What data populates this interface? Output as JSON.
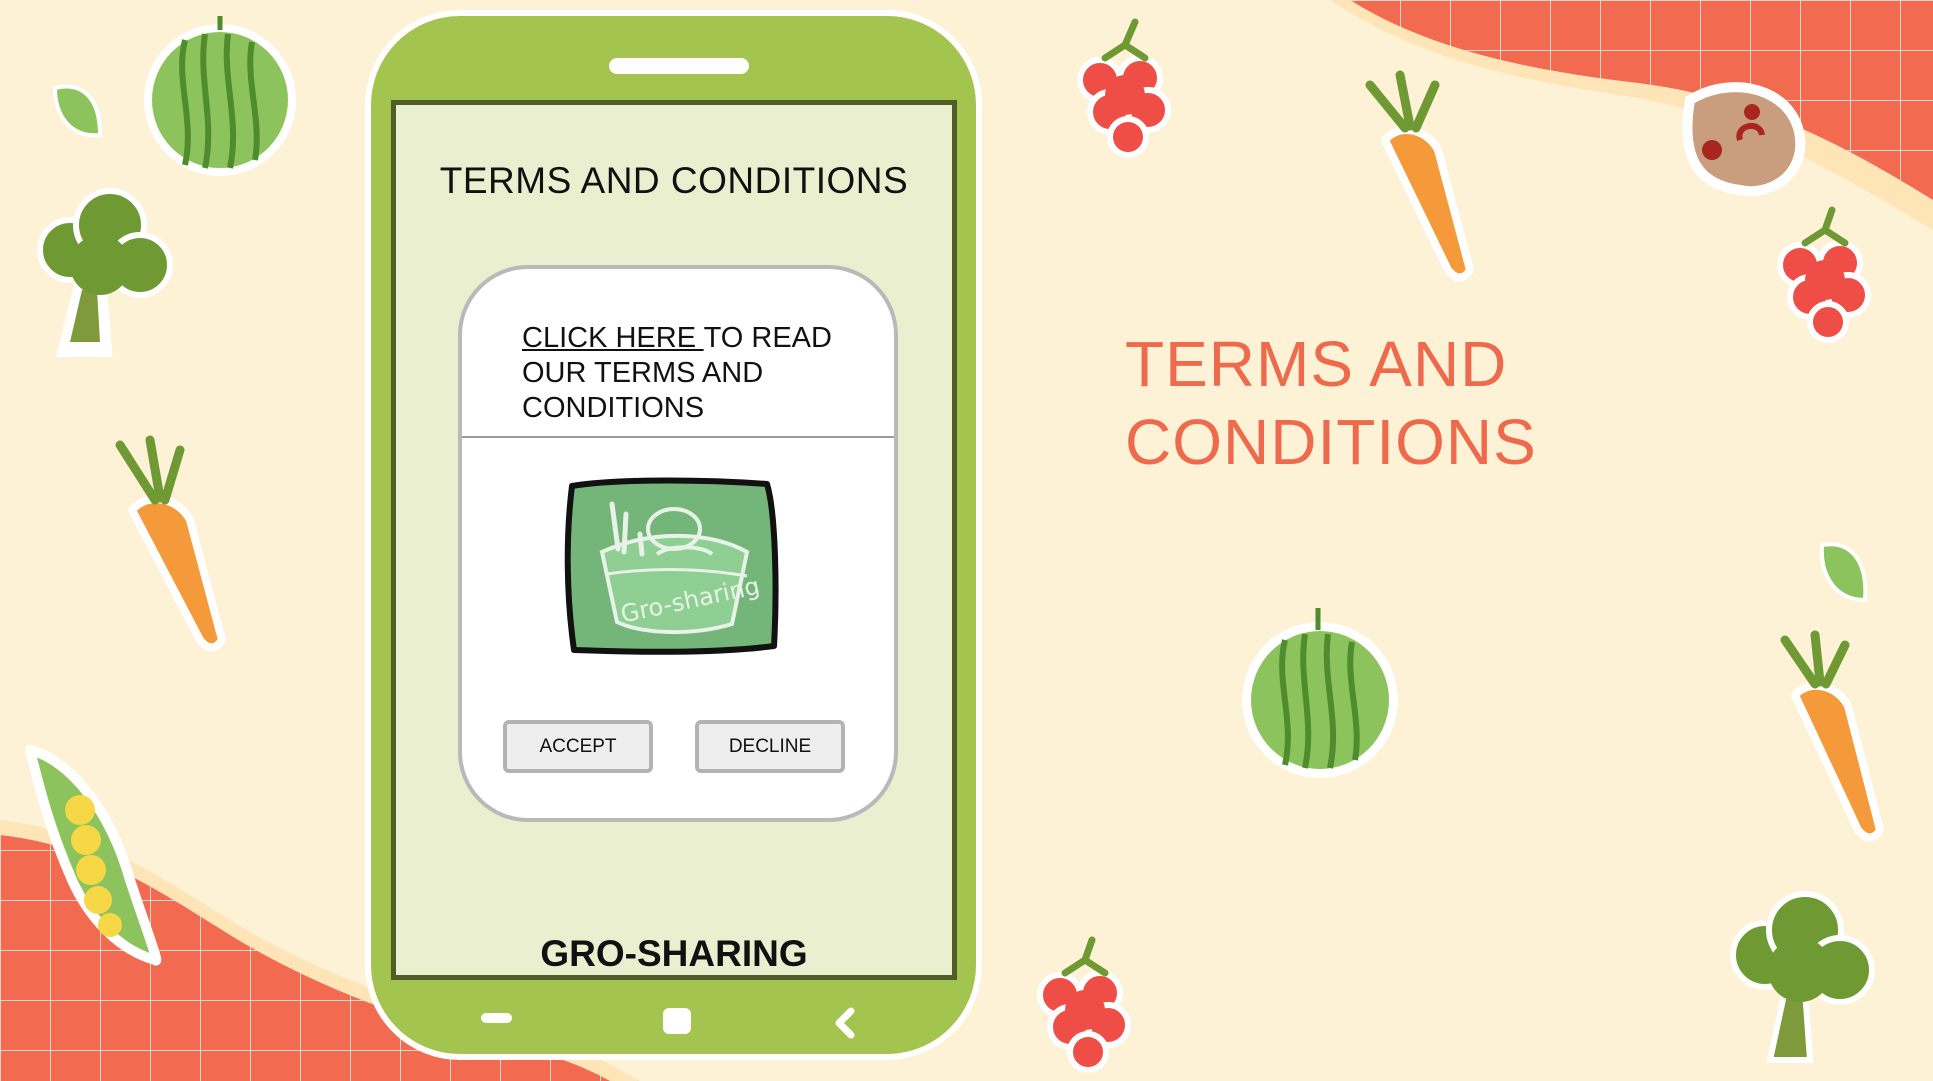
{
  "screen": {
    "title": "TERMS AND CONDITIONS",
    "dialog": {
      "link_text": "CLICK HERE ",
      "text_rest": "TO READ OUR TERMS AND CONDITIONS",
      "logo_icon": "gro-sharing-basket-logo",
      "accept_label": "ACCEPT",
      "decline_label": "DECLINE"
    },
    "app_name": "GRO-SHARING",
    "navbar": {
      "recent_icon": "recent-apps-icon",
      "home_icon": "home-icon",
      "back_icon": "back-chevron-icon"
    }
  },
  "slide_heading_line1": "TERMS AND",
  "slide_heading_line2": "CONDITIONS",
  "decor_icons": [
    "watermelon-icon",
    "broccoli-icon",
    "carrot-icon",
    "pea-pod-icon",
    "raspberry-icon",
    "mushroom-icon",
    "leaf-icon"
  ],
  "colors": {
    "background": "#fdf1d6",
    "grid_accent": "#f26a50",
    "phone_body": "#a3c44f",
    "screen_bg": "#e9efcf",
    "heading": "#ee6a4d"
  }
}
